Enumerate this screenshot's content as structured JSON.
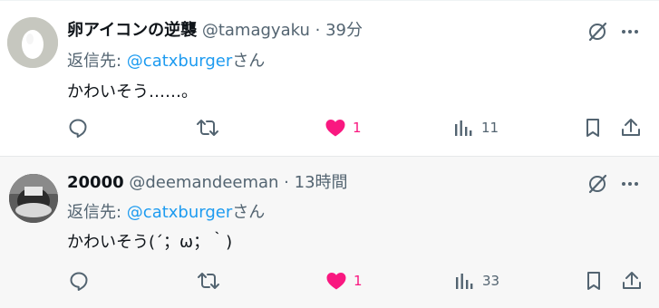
{
  "posts": [
    {
      "display_name": "卵アイコンの逆襲",
      "handle": "@tamagyaku",
      "time": "39分",
      "reply_prefix": "返信先: ",
      "reply_to": "@catxburger",
      "reply_suffix": "さん",
      "text": "かわいそう……。",
      "likes": "1",
      "views": "11",
      "liked": true
    },
    {
      "display_name": "20000",
      "handle": "@deemandeeman",
      "time": "13時間",
      "reply_prefix": "返信先: ",
      "reply_to": "@catxburger",
      "reply_suffix": "さん",
      "text": "かわいそう(´；ω；｀)",
      "likes": "1",
      "views": "33",
      "liked": true
    }
  ],
  "separator": " · ",
  "colors": {
    "like": "#f91880",
    "link": "#1d9bf0",
    "secondary_text": "#536471",
    "icon": "#536471"
  },
  "icons": [
    "reply-icon",
    "repost-icon",
    "like-icon",
    "views-icon",
    "bookmark-icon",
    "share-icon",
    "grok-icon",
    "more-icon"
  ]
}
